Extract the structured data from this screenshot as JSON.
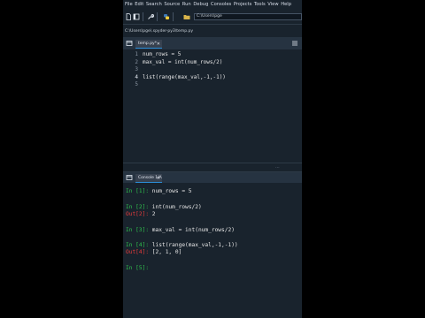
{
  "menu": [
    "File",
    "Edit",
    "Search",
    "Source",
    "Run",
    "Debug",
    "Consoles",
    "Projects",
    "Tools",
    "View",
    "Help"
  ],
  "toolbar": {
    "icons": [
      "file-icon",
      "panel-icon",
      "wrench-icon",
      "python-icon",
      "folder-icon"
    ],
    "working_dir": "C:\\Users\\pge"
  },
  "editor": {
    "file_path": "C:\\Users\\pge\\.spyder-py3\\temp.py",
    "tab_label": "temp.py*",
    "lines": [
      {
        "num": "1",
        "code": "num_rows = 5"
      },
      {
        "num": "2",
        "code": "max_val = int(num_rows/2)"
      },
      {
        "num": "3",
        "code": ""
      },
      {
        "num": "4",
        "code": "list(range(max_val,-1,-1))"
      },
      {
        "num": "5",
        "code": ""
      }
    ],
    "current_line": "4"
  },
  "console": {
    "tab_label": "Console 1/A",
    "entries": [
      {
        "prompt": "In [1]:",
        "kind": "in",
        "text": " num_rows = 5"
      },
      {
        "prompt": "In [2]:",
        "kind": "in",
        "text": " int(num_rows/2)"
      },
      {
        "prompt": "Out[2]:",
        "kind": "out",
        "text": " 2"
      },
      {
        "prompt": "In [3]:",
        "kind": "in",
        "text": " max_val = int(num_rows/2)"
      },
      {
        "prompt": "In [4]:",
        "kind": "in",
        "text": " list(range(max_val,-1,-1))"
      },
      {
        "prompt": "Out[4]:",
        "kind": "out",
        "text": " [2, 1, 0]"
      },
      {
        "prompt": "In [5]:",
        "kind": "in",
        "text": ""
      }
    ]
  },
  "colors": {
    "background": "#19232d",
    "in_prompt": "#2fbf4d",
    "out_prompt": "#e53b3b",
    "accent": "#2b8cd6"
  }
}
